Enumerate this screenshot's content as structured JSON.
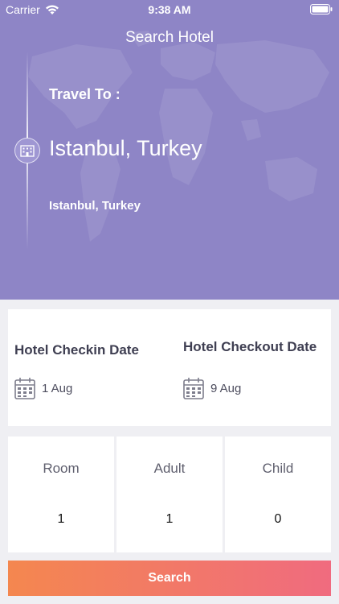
{
  "status_bar": {
    "carrier": "Carrier",
    "time": "9:38 AM"
  },
  "header": {
    "title": "Search Hotel"
  },
  "destination": {
    "label": "Travel To :",
    "city": "Istanbul, Turkey",
    "subtitle": "Istanbul, Turkey"
  },
  "dates": {
    "checkin_label": "Hotel Checkin Date",
    "checkin_value": "1 Aug",
    "checkout_label": "Hotel Checkout Date",
    "checkout_value": "9 Aug"
  },
  "guests": [
    {
      "label": "Room",
      "value": "1"
    },
    {
      "label": "Adult",
      "value": "1"
    },
    {
      "label": "Child",
      "value": "0"
    }
  ],
  "actions": {
    "search_label": "Search"
  },
  "colors": {
    "hero": "#8e85c6",
    "button_start": "#f4874f",
    "button_end": "#f06b7f",
    "background": "#efeff3"
  },
  "icons": [
    "wifi-icon",
    "battery-icon",
    "hotel-building-icon",
    "calendar-icon"
  ]
}
